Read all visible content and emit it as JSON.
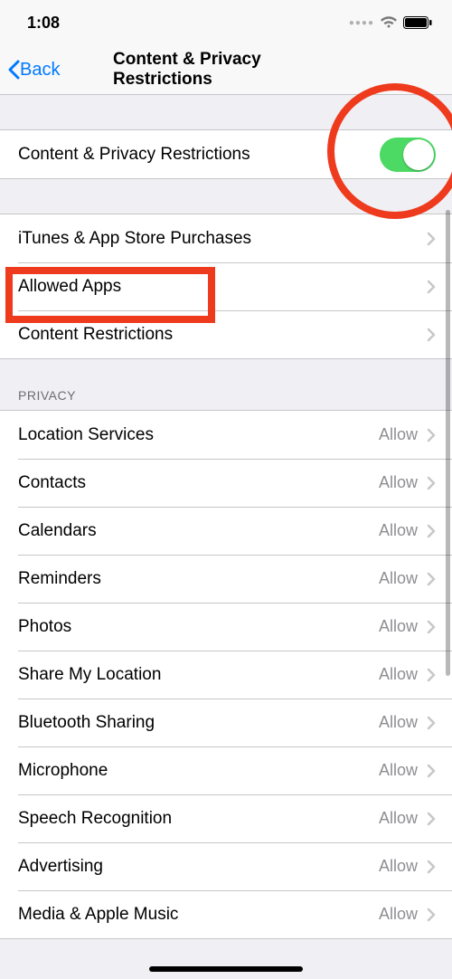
{
  "status": {
    "time": "1:08"
  },
  "nav": {
    "back": "Back",
    "title": "Content & Privacy Restrictions"
  },
  "toggle_row": {
    "label": "Content & Privacy Restrictions",
    "on": true
  },
  "rows_group1": [
    {
      "label": "iTunes & App Store Purchases"
    },
    {
      "label": "Allowed Apps"
    },
    {
      "label": "Content Restrictions"
    }
  ],
  "privacy_header": "Privacy",
  "privacy_rows": [
    {
      "label": "Location Services",
      "value": "Allow"
    },
    {
      "label": "Contacts",
      "value": "Allow"
    },
    {
      "label": "Calendars",
      "value": "Allow"
    },
    {
      "label": "Reminders",
      "value": "Allow"
    },
    {
      "label": "Photos",
      "value": "Allow"
    },
    {
      "label": "Share My Location",
      "value": "Allow"
    },
    {
      "label": "Bluetooth Sharing",
      "value": "Allow"
    },
    {
      "label": "Microphone",
      "value": "Allow"
    },
    {
      "label": "Speech Recognition",
      "value": "Allow"
    },
    {
      "label": "Advertising",
      "value": "Allow"
    },
    {
      "label": "Media & Apple Music",
      "value": "Allow"
    }
  ]
}
